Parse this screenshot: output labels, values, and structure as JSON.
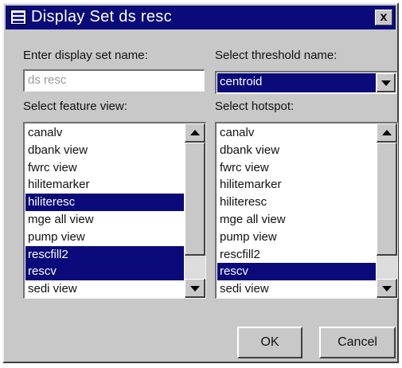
{
  "window": {
    "title": "Display Set ds resc",
    "close_label": "x"
  },
  "name": {
    "label": "Enter display set name:",
    "value": "ds resc"
  },
  "threshold": {
    "label": "Select threshold name:",
    "selected": "centroid"
  },
  "feature_view": {
    "label": "Select feature view:",
    "items": [
      {
        "text": "canalv",
        "selected": false
      },
      {
        "text": "dbank view",
        "selected": false
      },
      {
        "text": "fwrc view",
        "selected": false
      },
      {
        "text": "hilitemarker",
        "selected": false
      },
      {
        "text": "hiliteresc",
        "selected": true
      },
      {
        "text": "mge all view",
        "selected": false
      },
      {
        "text": "pump view",
        "selected": false
      },
      {
        "text": "rescfill2",
        "selected": true
      },
      {
        "text": "rescv",
        "selected": true
      },
      {
        "text": "sedi view",
        "selected": false
      }
    ]
  },
  "hotspot": {
    "label": "Select hotspot:",
    "items": [
      {
        "text": "canalv",
        "selected": false
      },
      {
        "text": "dbank view",
        "selected": false
      },
      {
        "text": "fwrc view",
        "selected": false
      },
      {
        "text": "hilitemarker",
        "selected": false
      },
      {
        "text": "hiliteresc",
        "selected": false
      },
      {
        "text": "mge all view",
        "selected": false
      },
      {
        "text": "pump view",
        "selected": false
      },
      {
        "text": "rescfill2",
        "selected": false
      },
      {
        "text": "rescv",
        "selected": true
      },
      {
        "text": "sedi view",
        "selected": false
      }
    ]
  },
  "buttons": {
    "ok": "OK",
    "cancel": "Cancel"
  },
  "colors": {
    "selection": "#0a0a7a",
    "face": "#c8c8c8"
  }
}
